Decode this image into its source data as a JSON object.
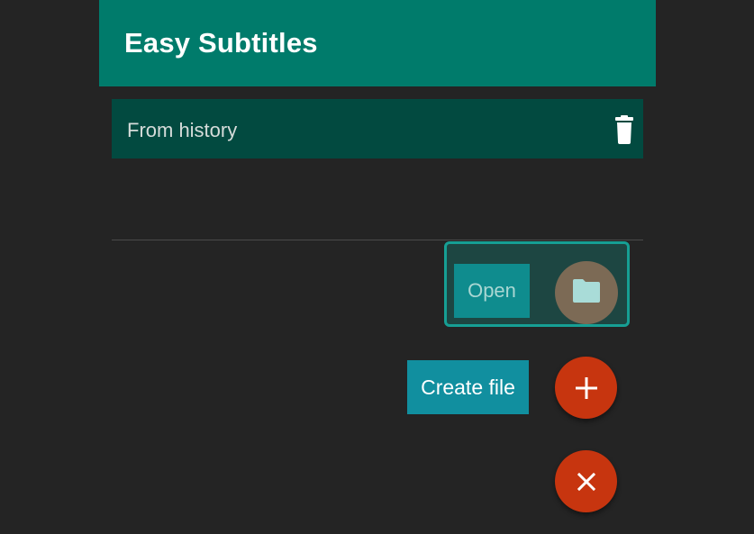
{
  "app": {
    "title": "Easy Subtitles"
  },
  "history": {
    "label": "From history",
    "delete_icon": "trash-icon"
  },
  "speed_dial": {
    "open_label": "Open",
    "open_icon": "folder-icon",
    "create_label": "Create file",
    "create_icon": "plus-icon",
    "close_icon": "close-icon"
  },
  "colors": {
    "primary": "#007b6b",
    "primary_dark": "#024a40",
    "accent": "#c7350f",
    "label_bg": "#118f9f",
    "background": "#242424"
  }
}
